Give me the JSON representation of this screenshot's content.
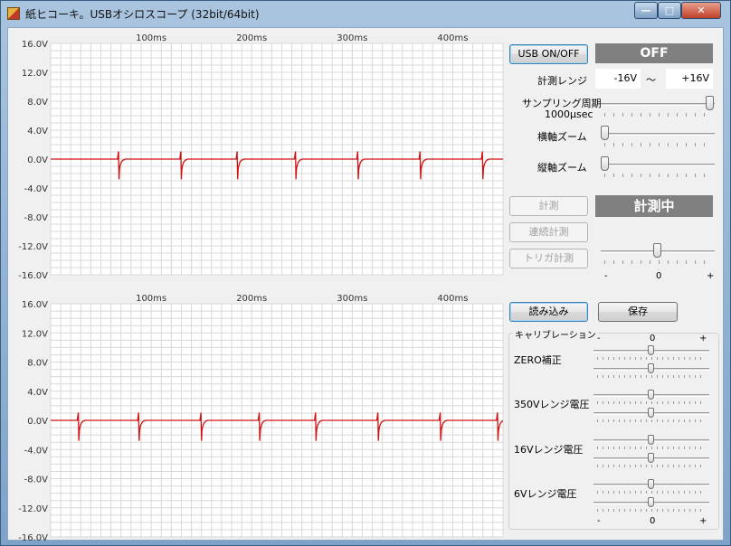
{
  "window": {
    "title": "紙ヒコーキ。USBオシロスコープ (32bit/64bit)",
    "minimize_glyph": "—",
    "maximize_glyph": "□",
    "close_glyph": "✕"
  },
  "scope": {
    "y_labels": [
      "16.0V",
      "12.0V",
      "8.0V",
      "4.0V",
      "0.0V",
      "-4.0V",
      "-8.0V",
      "-12.0V",
      "-16.0V"
    ],
    "x_labels": [
      "100ms",
      "200ms",
      "300ms",
      "400ms"
    ],
    "y_range": [
      -16,
      16
    ],
    "x_range_ms": [
      0,
      450
    ],
    "grid_color": "#d8d8d8",
    "trace_color": "#d01010",
    "trace1_spikes_ms": [
      68,
      130,
      186,
      244,
      306,
      368,
      430
    ],
    "trace2_spikes_ms": [
      28,
      88,
      150,
      208,
      264,
      326,
      388,
      445
    ]
  },
  "controls": {
    "usb_button": "USB ON/OFF",
    "usb_status": "OFF",
    "range_label": "計測レンジ",
    "range_min": "-16V",
    "range_sep": "〜",
    "range_max": "+16V",
    "sampling_label": "サンプリング周期",
    "sampling_value": "1000μsec",
    "h_zoom_label": "横軸ズーム",
    "v_zoom_label": "縦軸ズーム",
    "measure_button": "計測",
    "measure_status": "計測中",
    "continuous_button": "連続計測",
    "trigger_button": "トリガ計測",
    "trigger_minus": "-",
    "trigger_zero": "0",
    "trigger_plus": "+",
    "load_button": "読み込み",
    "save_button": "保存",
    "sampling_level": 1.0,
    "h_zoom_level": 0.0,
    "v_zoom_level": 0.0,
    "trigger_level": 0.5
  },
  "calibration": {
    "title": "キャリブレーション",
    "minus": "-",
    "zero": "0",
    "plus": "+",
    "items": [
      {
        "label": "ZERO補正"
      },
      {
        "label": "350Vレンジ電圧"
      },
      {
        "label": "16Vレンジ電圧"
      },
      {
        "label": "6Vレンジ電圧"
      }
    ]
  }
}
